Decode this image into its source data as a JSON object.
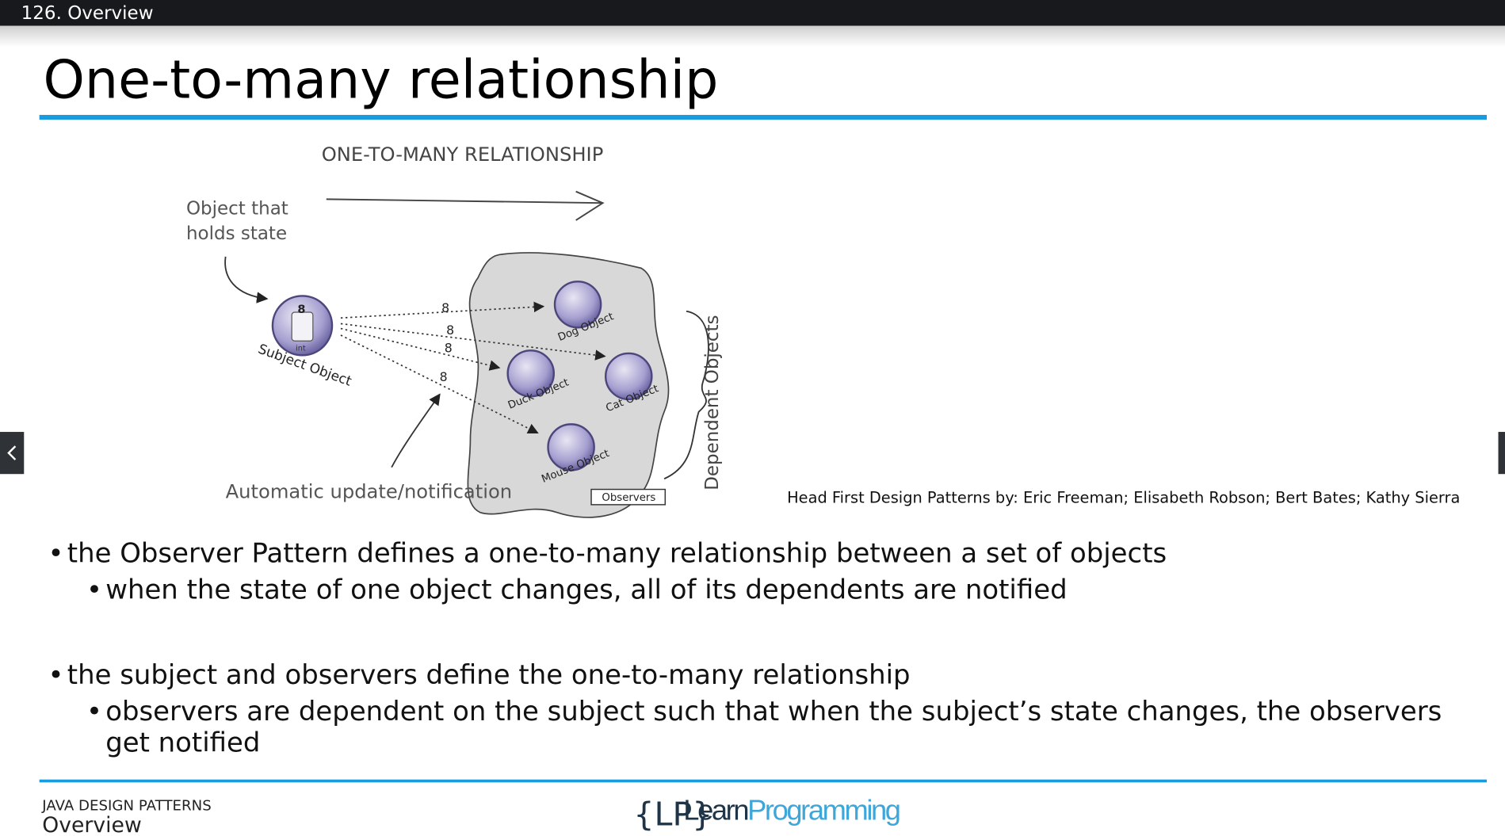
{
  "header": {
    "lesson_title": "126. Overview"
  },
  "slide": {
    "title": "One-to-many relationship",
    "diagram": {
      "banner": "ONE-TO-MANY RELATIONSHIP",
      "state_label_line1": "Object that",
      "state_label_line2": "holds state",
      "subject_label": "Subject Object",
      "subject_value": "8",
      "subject_base": "int",
      "arrow_values": [
        "8",
        "8",
        "8",
        "8"
      ],
      "dependents": [
        "Dog Object",
        "Duck Object",
        "Cat Object",
        "Mouse Object"
      ],
      "observers_box": "Observers",
      "dependent_label": "Dependent Objects",
      "notification_label": "Automatic update/notification",
      "accent_color": "#8e86c1"
    },
    "credit": "Head First Design Patterns by: Eric Freeman; Elisabeth Robson; Bert Bates; Kathy Sierra",
    "bullets": [
      {
        "text": "the Observer Pattern defines a one-to-many relationship between a set of objects",
        "sub": "when the state of one object changes, all of its dependents are notified"
      },
      {
        "text": "the subject and observers define the one-to-many relationship",
        "sub_line1": "observers are dependent on the subject such that when the subject’s state changes, the observers",
        "sub_line2": "get notified"
      }
    ]
  },
  "footer": {
    "course": "JAVA DESIGN PATTERNS",
    "section": "Overview",
    "logo_bracket": "{LP}",
    "logo_lead": "Learn",
    "logo_rest": "Programming"
  },
  "navigation": {
    "prev_icon": "chevron-left-icon",
    "next_icon": "chevron-right-icon"
  },
  "colors": {
    "top_bar": "#17191c",
    "rule": "#1a9be0",
    "logo": "#3fa6d9"
  }
}
